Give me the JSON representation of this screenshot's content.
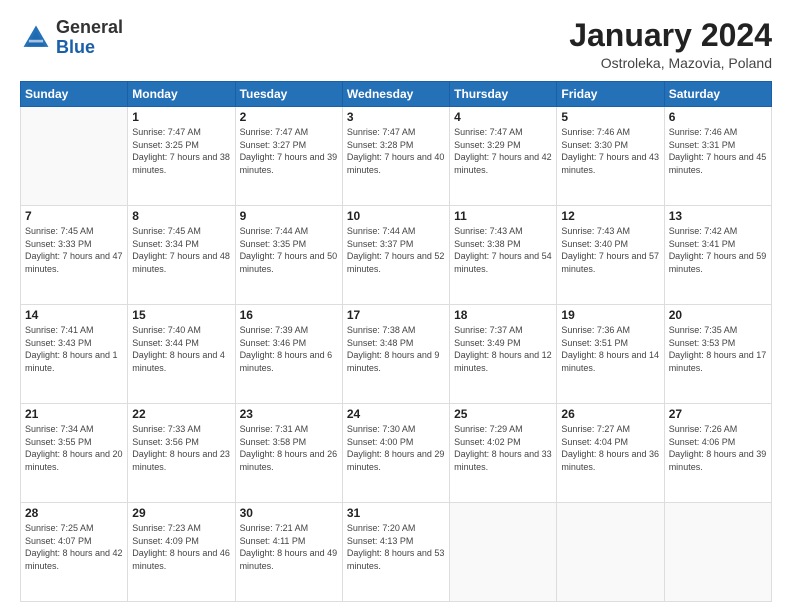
{
  "header": {
    "logo_general": "General",
    "logo_blue": "Blue",
    "month_title": "January 2024",
    "location": "Ostroleka, Mazovia, Poland"
  },
  "weekdays": [
    "Sunday",
    "Monday",
    "Tuesday",
    "Wednesday",
    "Thursday",
    "Friday",
    "Saturday"
  ],
  "weeks": [
    [
      {
        "day": "",
        "sunrise": "",
        "sunset": "",
        "daylight": ""
      },
      {
        "day": "1",
        "sunrise": "Sunrise: 7:47 AM",
        "sunset": "Sunset: 3:25 PM",
        "daylight": "Daylight: 7 hours and 38 minutes."
      },
      {
        "day": "2",
        "sunrise": "Sunrise: 7:47 AM",
        "sunset": "Sunset: 3:27 PM",
        "daylight": "Daylight: 7 hours and 39 minutes."
      },
      {
        "day": "3",
        "sunrise": "Sunrise: 7:47 AM",
        "sunset": "Sunset: 3:28 PM",
        "daylight": "Daylight: 7 hours and 40 minutes."
      },
      {
        "day": "4",
        "sunrise": "Sunrise: 7:47 AM",
        "sunset": "Sunset: 3:29 PM",
        "daylight": "Daylight: 7 hours and 42 minutes."
      },
      {
        "day": "5",
        "sunrise": "Sunrise: 7:46 AM",
        "sunset": "Sunset: 3:30 PM",
        "daylight": "Daylight: 7 hours and 43 minutes."
      },
      {
        "day": "6",
        "sunrise": "Sunrise: 7:46 AM",
        "sunset": "Sunset: 3:31 PM",
        "daylight": "Daylight: 7 hours and 45 minutes."
      }
    ],
    [
      {
        "day": "7",
        "sunrise": "Sunrise: 7:45 AM",
        "sunset": "Sunset: 3:33 PM",
        "daylight": "Daylight: 7 hours and 47 minutes."
      },
      {
        "day": "8",
        "sunrise": "Sunrise: 7:45 AM",
        "sunset": "Sunset: 3:34 PM",
        "daylight": "Daylight: 7 hours and 48 minutes."
      },
      {
        "day": "9",
        "sunrise": "Sunrise: 7:44 AM",
        "sunset": "Sunset: 3:35 PM",
        "daylight": "Daylight: 7 hours and 50 minutes."
      },
      {
        "day": "10",
        "sunrise": "Sunrise: 7:44 AM",
        "sunset": "Sunset: 3:37 PM",
        "daylight": "Daylight: 7 hours and 52 minutes."
      },
      {
        "day": "11",
        "sunrise": "Sunrise: 7:43 AM",
        "sunset": "Sunset: 3:38 PM",
        "daylight": "Daylight: 7 hours and 54 minutes."
      },
      {
        "day": "12",
        "sunrise": "Sunrise: 7:43 AM",
        "sunset": "Sunset: 3:40 PM",
        "daylight": "Daylight: 7 hours and 57 minutes."
      },
      {
        "day": "13",
        "sunrise": "Sunrise: 7:42 AM",
        "sunset": "Sunset: 3:41 PM",
        "daylight": "Daylight: 7 hours and 59 minutes."
      }
    ],
    [
      {
        "day": "14",
        "sunrise": "Sunrise: 7:41 AM",
        "sunset": "Sunset: 3:43 PM",
        "daylight": "Daylight: 8 hours and 1 minute."
      },
      {
        "day": "15",
        "sunrise": "Sunrise: 7:40 AM",
        "sunset": "Sunset: 3:44 PM",
        "daylight": "Daylight: 8 hours and 4 minutes."
      },
      {
        "day": "16",
        "sunrise": "Sunrise: 7:39 AM",
        "sunset": "Sunset: 3:46 PM",
        "daylight": "Daylight: 8 hours and 6 minutes."
      },
      {
        "day": "17",
        "sunrise": "Sunrise: 7:38 AM",
        "sunset": "Sunset: 3:48 PM",
        "daylight": "Daylight: 8 hours and 9 minutes."
      },
      {
        "day": "18",
        "sunrise": "Sunrise: 7:37 AM",
        "sunset": "Sunset: 3:49 PM",
        "daylight": "Daylight: 8 hours and 12 minutes."
      },
      {
        "day": "19",
        "sunrise": "Sunrise: 7:36 AM",
        "sunset": "Sunset: 3:51 PM",
        "daylight": "Daylight: 8 hours and 14 minutes."
      },
      {
        "day": "20",
        "sunrise": "Sunrise: 7:35 AM",
        "sunset": "Sunset: 3:53 PM",
        "daylight": "Daylight: 8 hours and 17 minutes."
      }
    ],
    [
      {
        "day": "21",
        "sunrise": "Sunrise: 7:34 AM",
        "sunset": "Sunset: 3:55 PM",
        "daylight": "Daylight: 8 hours and 20 minutes."
      },
      {
        "day": "22",
        "sunrise": "Sunrise: 7:33 AM",
        "sunset": "Sunset: 3:56 PM",
        "daylight": "Daylight: 8 hours and 23 minutes."
      },
      {
        "day": "23",
        "sunrise": "Sunrise: 7:31 AM",
        "sunset": "Sunset: 3:58 PM",
        "daylight": "Daylight: 8 hours and 26 minutes."
      },
      {
        "day": "24",
        "sunrise": "Sunrise: 7:30 AM",
        "sunset": "Sunset: 4:00 PM",
        "daylight": "Daylight: 8 hours and 29 minutes."
      },
      {
        "day": "25",
        "sunrise": "Sunrise: 7:29 AM",
        "sunset": "Sunset: 4:02 PM",
        "daylight": "Daylight: 8 hours and 33 minutes."
      },
      {
        "day": "26",
        "sunrise": "Sunrise: 7:27 AM",
        "sunset": "Sunset: 4:04 PM",
        "daylight": "Daylight: 8 hours and 36 minutes."
      },
      {
        "day": "27",
        "sunrise": "Sunrise: 7:26 AM",
        "sunset": "Sunset: 4:06 PM",
        "daylight": "Daylight: 8 hours and 39 minutes."
      }
    ],
    [
      {
        "day": "28",
        "sunrise": "Sunrise: 7:25 AM",
        "sunset": "Sunset: 4:07 PM",
        "daylight": "Daylight: 8 hours and 42 minutes."
      },
      {
        "day": "29",
        "sunrise": "Sunrise: 7:23 AM",
        "sunset": "Sunset: 4:09 PM",
        "daylight": "Daylight: 8 hours and 46 minutes."
      },
      {
        "day": "30",
        "sunrise": "Sunrise: 7:21 AM",
        "sunset": "Sunset: 4:11 PM",
        "daylight": "Daylight: 8 hours and 49 minutes."
      },
      {
        "day": "31",
        "sunrise": "Sunrise: 7:20 AM",
        "sunset": "Sunset: 4:13 PM",
        "daylight": "Daylight: 8 hours and 53 minutes."
      },
      {
        "day": "",
        "sunrise": "",
        "sunset": "",
        "daylight": ""
      },
      {
        "day": "",
        "sunrise": "",
        "sunset": "",
        "daylight": ""
      },
      {
        "day": "",
        "sunrise": "",
        "sunset": "",
        "daylight": ""
      }
    ]
  ]
}
